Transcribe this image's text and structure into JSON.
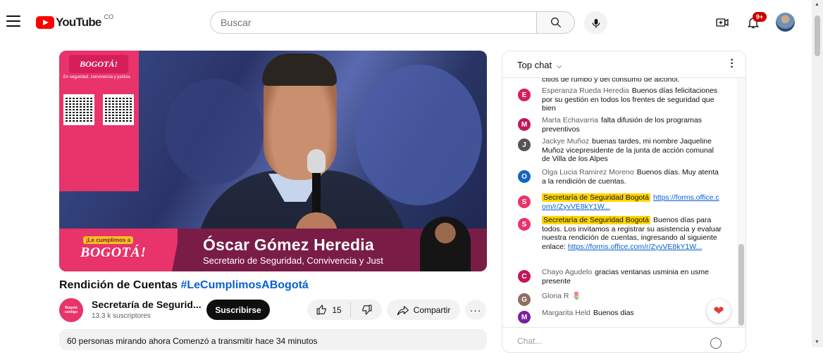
{
  "header": {
    "logo_text": "YouTube",
    "logo_country": "CO",
    "search_placeholder": "Buscar",
    "notifications_badge": "9+",
    "icons": [
      "menu-icon",
      "search-icon",
      "mic-icon",
      "create-video-icon",
      "bell-icon"
    ]
  },
  "video": {
    "panel_logo": "BOGOTÁ!",
    "panel_sub": "En seguridad, convivencia y justicia",
    "lower_third_tag": "¡Le cumplimos a",
    "lower_third_logo": "BOGOTÁ!",
    "speaker_name": "Óscar Gómez Heredia",
    "speaker_title": "Secretario de Seguridad, Convivencia y Just"
  },
  "title": {
    "text": "Rendición de Cuentas ",
    "hashtag": "#LeCumplimosABogotá"
  },
  "channel": {
    "avatar_text": "Bogotá contigo",
    "name": "Secretaría de Segurid...",
    "subscribers": "13.3 k suscriptores",
    "subscribe_label": "Suscribirse"
  },
  "actions": {
    "like_count": "15",
    "share_label": "Compartir",
    "more_label": "···"
  },
  "description": {
    "text": "60 personas mirando ahora  Comenzó a transmitir hace 34 minutos"
  },
  "chat": {
    "title": "Top chat",
    "cut_line": "citios de rumbo y del consumo de alcohol.",
    "input_placeholder": "Chat...",
    "messages": [
      {
        "initial": "E",
        "color": "#d81b60",
        "author": "Esperanza Rueda Heredia",
        "text": "Buenos días felicitaciones por su gestión en todos los frentes de seguridad que bien",
        "link": ""
      },
      {
        "initial": "M",
        "color": "#c2185b",
        "author": "Marta Echavarria",
        "text": "falta difusión de los programas preventivos",
        "link": ""
      },
      {
        "initial": "J",
        "color": "#555555",
        "author": "Jackye Muñoz",
        "text": "buenas tardes, mi nombre Jaqueline Muñoz vicepresidente de la junta de acción comunal de Villa de los Alpes",
        "link": ""
      },
      {
        "initial": "O",
        "color": "#1565c0",
        "author": "Olga Lucia Ramirez Moreno",
        "text": "Buenos días. Muy atenta a la rendición de cuentas.",
        "link": ""
      },
      {
        "initial": "S",
        "color": "#e8336b",
        "author": "Secretaría de Seguridad Bogotá",
        "text": "",
        "link": "https://forms.office.com/r/ZyvVE8kY1W..."
      },
      {
        "initial": "S",
        "color": "#e8336b",
        "author": "Secretaría de Seguridad Bogotá",
        "text": "Buenos días para todos. Los invitamos a registrar su asistencia y evaluar nuestra rendición de cuentas, ingresando al siguiente enlace:",
        "link": "https://forms.office.com/r/ZyvVE8kY1W..."
      },
      {
        "initial": "C",
        "color": "#c2185b",
        "author": "Chayo Agudelo",
        "text": "gracias ventanas usminia en usme presente",
        "link": ""
      },
      {
        "initial": "G",
        "color": "#8d6e63",
        "author": "Gloria R",
        "text": "🌷",
        "link": ""
      },
      {
        "initial": "M",
        "color": "#7b1fa2",
        "author": "Margarita Held",
        "text": "Buenos dias",
        "link": ""
      }
    ]
  }
}
